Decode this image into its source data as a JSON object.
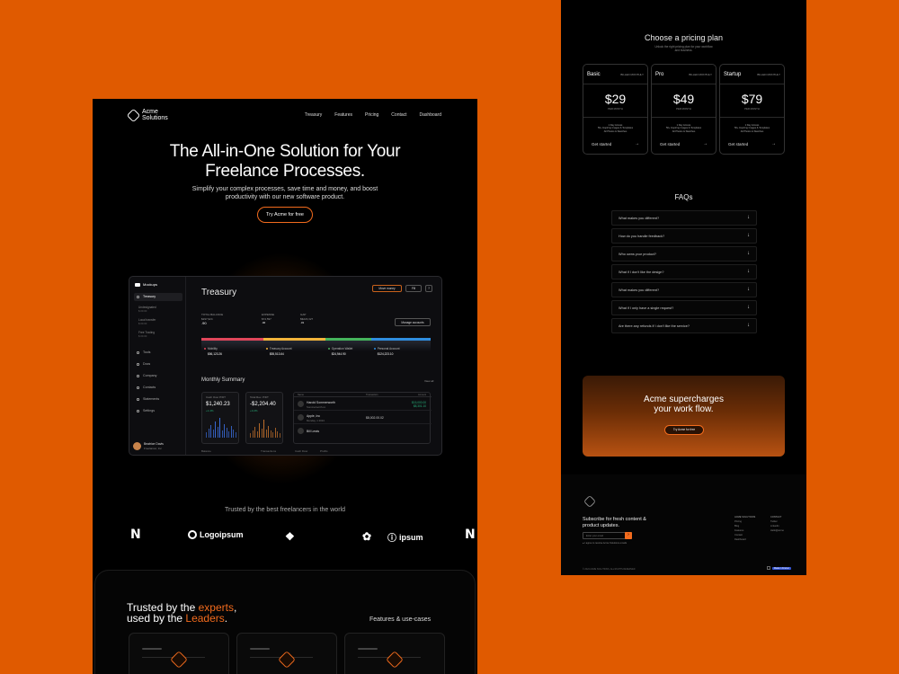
{
  "left_page": {
    "logo_text_line1": "Acme",
    "logo_text_line2": "Solutions",
    "nav": [
      "Treasury",
      "Features",
      "Pricing",
      "Contact",
      "Dashboard"
    ],
    "hero_title_line1": "The All-in-One Solution for Your",
    "hero_title_line2": "Freelance Processes.",
    "hero_sub_line1": "Simplify your complex processes, save time and money, and boost",
    "hero_sub_line2": "productivity with our new software product.",
    "cta_label": "Try Acme for free",
    "dashboard": {
      "brand": "Mockups",
      "sidebar": {
        "treasury": "Treasury",
        "accounts": [
          {
            "name": "Undesignated",
            "sub": "$ 00.00"
          },
          {
            "name": "Local transfer",
            "sub": "$ 00.00"
          },
          {
            "name": "Free Trading",
            "sub": "$ 00.00"
          }
        ],
        "items": [
          "Tools",
          "Docs",
          "Company",
          "Contacts",
          "Statements",
          "Settings"
        ],
        "user_name": "Beatrice Davis",
        "user_sub": "Freelancer, Inc"
      },
      "title": "Treasury",
      "buttons": [
        "Move money",
        "Fill",
        "?"
      ],
      "stats": [
        {
          "label": "TOTAL BALANCE",
          "value": "$297,924",
          "cents": ".90"
        },
        {
          "label": "EXPENSE",
          "value": "$74,597",
          "cents": ".40"
        },
        {
          "label": "GAP",
          "value": "$$223,327",
          "cents": ".31"
        }
      ],
      "manage_button": "Manage accounts",
      "progress": [
        {
          "name": "Mobility",
          "value": "$56,123.26",
          "color": "#e0465a",
          "fraction": 0.27
        },
        {
          "name": "Treasury Account",
          "value": "$55,513.64",
          "color": "#f2b43a",
          "fraction": 0.27
        },
        {
          "name": "Operation Wallet",
          "value": "$24,944.90",
          "color": "#45b45c",
          "fraction": 0.2
        },
        {
          "name": "Personal Account",
          "value": "$124,223.10",
          "color": "#2f8ee0",
          "fraction": 0.26
        }
      ],
      "monthly_summary": "Monthly Summary",
      "view_all": "View all",
      "cards": [
        {
          "label": "Cash Over P/DT",
          "value": "$1,240.23",
          "delta": "+1.4%",
          "delta_color": "#27b07a"
        },
        {
          "label": "Total Rev. P/DT",
          "value": "-$2,204.40",
          "delta": "+3.2%",
          "delta_color": "#27b07a"
        }
      ],
      "table": {
        "headers": [
          "Name",
          "Transaction",
          "Amount"
        ],
        "rows": [
          {
            "name": "Harold Sommerworth",
            "sub": "Sommerworth.co",
            "mid": "",
            "right1": "$15,000.00",
            "right2": "$8,301.10"
          },
          {
            "name": "Apple, Inc",
            "sub": "Monday, 1 2024",
            "mid": "$8,002.00.02",
            "right1": "",
            "right2": ""
          },
          {
            "name": "Bill Lewis",
            "sub": "",
            "mid": "",
            "right1": "",
            "right2": ""
          }
        ]
      },
      "footer_labels": [
        "Balance",
        "Transactions",
        "Cash Flow",
        "Profits"
      ]
    },
    "trusted_text": "Trusted by the best freelancers in the world",
    "brands": [
      "Logoipsum",
      "ipsum"
    ],
    "section_title_part1": "Trusted by the ",
    "section_title_accent1": "experts",
    "section_title_comma": ",",
    "section_title_part2": "used by the ",
    "section_title_accent2": "Leaders",
    "section_title_end": ".",
    "section_right": "Features & use-cases"
  },
  "right_page": {
    "pricing_title": "Choose a pricing plan",
    "pricing_sub_line1": "Unlock the right pricing plan for your workflow",
    "pricing_sub_line2": "and business.",
    "plans": [
      {
        "name": "Basic",
        "billing": "BILLED MONTHLY",
        "price": "$29",
        "per": "PER MONTH",
        "features": [
          "1 Day Access",
          "50+ Inspiring Images & Templates",
          "All Photos & Sketches"
        ],
        "cta": "Get started"
      },
      {
        "name": "Pro",
        "billing": "BILLED MONTHLY",
        "price": "$49",
        "per": "PER MONTH",
        "features": [
          "1 Day Access",
          "50+ Inspiring Images & Templates",
          "All Photos & Sketches"
        ],
        "cta": "Get started"
      },
      {
        "name": "Startup",
        "billing": "BILLED MONTHLY",
        "price": "$79",
        "per": "PER MONTH",
        "features": [
          "1 Day Access",
          "50+ Inspiring Images & Templates",
          "All Photos & Sketches"
        ],
        "cta": "Get started"
      }
    ],
    "faq_title": "FAQs",
    "faqs": [
      "What makes you different?",
      "How do you handle feedback?",
      "Who owns your product?",
      "What if I don't like the design?",
      "What makes you different?",
      "What if I only have a single request?",
      "Are there any refunds if I don't like the service?"
    ],
    "faq_arrow": "↓",
    "cta_title_line1": "Acme supercharges",
    "cta_title_line2": "your work flow.",
    "cta_button": "Try Acme for free",
    "footer": {
      "subscribe_line1": "Subscribe for fresh content &",
      "subscribe_line2": "product updates.",
      "input_placeholder": "Enter your email",
      "agree_text": "I agree to receive Acme Solutions emails",
      "col1_title": "ACME SOLUTIONS",
      "col1_items": [
        "Pricing",
        "Blog",
        "Features",
        "Contact",
        "Dashboard"
      ],
      "col2_title": "CONTACT",
      "col2_items": [
        "Twitter",
        "Linkedin",
        "Hello@acme"
      ],
      "copyright": "© 2024 ACME SOLUTIONS, ALL RIGHTS RESERVED",
      "badge": "Made in Framer"
    }
  },
  "colors": {
    "page_bg": "#e05a00",
    "accent": "#f26b1d",
    "panel_bg": "#000000"
  }
}
